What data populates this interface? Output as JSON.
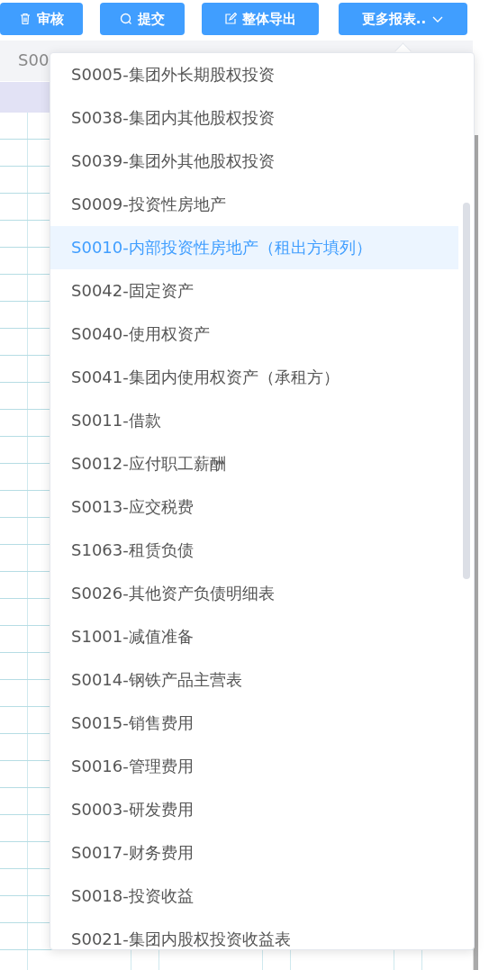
{
  "toolbar": [
    {
      "label": "审核",
      "kind": "delete"
    },
    {
      "label": "提交",
      "kind": "submit"
    },
    {
      "label": "整体导出",
      "kind": "export"
    },
    {
      "label": "更多报表..",
      "kind": "dropdown"
    }
  ],
  "tab_strip": {
    "text": "S00"
  },
  "menu": {
    "items": [
      {
        "label": "S0005-集团外长期股权投资",
        "selected": false
      },
      {
        "label": "S0038-集团内其他股权投资",
        "selected": false
      },
      {
        "label": "S0039-集团外其他股权投资",
        "selected": false
      },
      {
        "label": "S0009-投资性房地产",
        "selected": false
      },
      {
        "label": "S0010-内部投资性房地产（租出方填列）",
        "selected": true
      },
      {
        "label": "S0042-固定资产",
        "selected": false
      },
      {
        "label": "S0040-使用权资产",
        "selected": false
      },
      {
        "label": "S0041-集团内使用权资产（承租方）",
        "selected": false
      },
      {
        "label": "S0011-借款",
        "selected": false
      },
      {
        "label": "S0012-应付职工薪酬",
        "selected": false
      },
      {
        "label": "S0013-应交税费",
        "selected": false
      },
      {
        "label": "S1063-租赁负债",
        "selected": false
      },
      {
        "label": "S0026-其他资产负债明细表",
        "selected": false
      },
      {
        "label": "S1001-减值准备",
        "selected": false
      },
      {
        "label": "S0014-钢铁产品主营表",
        "selected": false
      },
      {
        "label": "S0015-销售费用",
        "selected": false
      },
      {
        "label": "S0016-管理费用",
        "selected": false
      },
      {
        "label": "S0003-研发费用",
        "selected": false
      },
      {
        "label": "S0017-财务费用",
        "selected": false
      },
      {
        "label": "S0018-投资收益",
        "selected": false
      },
      {
        "label": "S0021-集团内股权投资收益表",
        "selected": false
      }
    ]
  }
}
